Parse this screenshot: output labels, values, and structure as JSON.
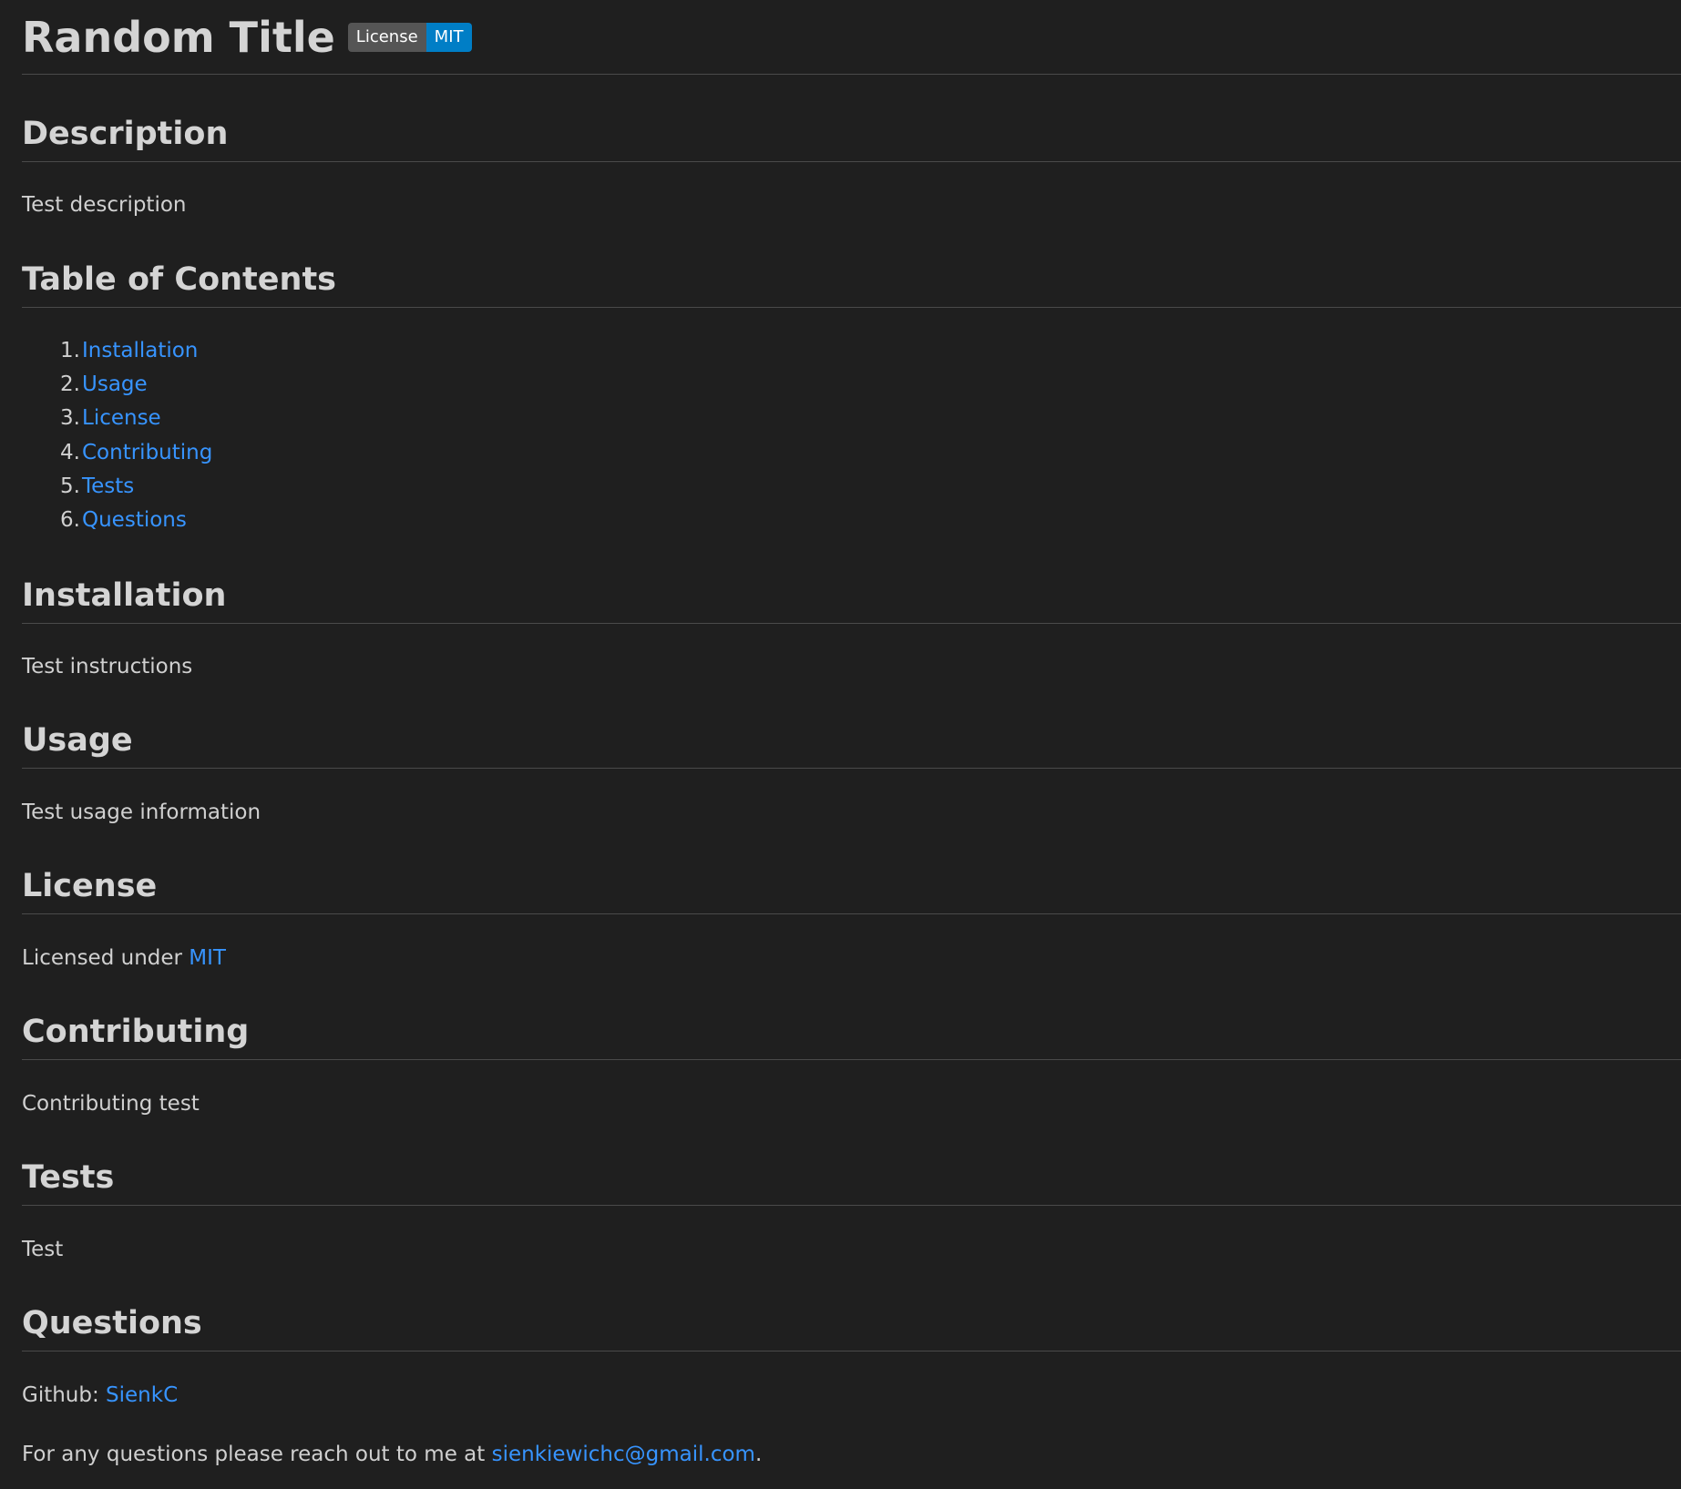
{
  "title": "Random Title",
  "badge": {
    "label": "License",
    "value": "MIT"
  },
  "sections": {
    "description": {
      "heading": "Description",
      "text": "Test description"
    },
    "toc": {
      "heading": "Table of Contents",
      "items": [
        {
          "num": "1.",
          "label": "Installation"
        },
        {
          "num": "2.",
          "label": "Usage"
        },
        {
          "num": "3.",
          "label": "License"
        },
        {
          "num": "4.",
          "label": "Contributing"
        },
        {
          "num": "5.",
          "label": "Tests"
        },
        {
          "num": "6.",
          "label": "Questions"
        }
      ]
    },
    "installation": {
      "heading": "Installation",
      "text": "Test instructions"
    },
    "usage": {
      "heading": "Usage",
      "text": "Test usage information"
    },
    "license": {
      "heading": "License",
      "text_prefix": "Licensed under ",
      "link": "MIT"
    },
    "contributing": {
      "heading": "Contributing",
      "text": "Contributing test"
    },
    "tests": {
      "heading": "Tests",
      "text": "Test"
    },
    "questions": {
      "heading": "Questions",
      "github_prefix": "Github: ",
      "github_link": "SienkC",
      "contact_prefix": "For any questions please reach out to me at ",
      "email": "sienkiewichc@gmail.com",
      "contact_suffix": "."
    }
  },
  "colors": {
    "background": "#1f1f1f",
    "link": "#3794ff",
    "badge_left": "#555555",
    "badge_right": "#007ec6"
  }
}
